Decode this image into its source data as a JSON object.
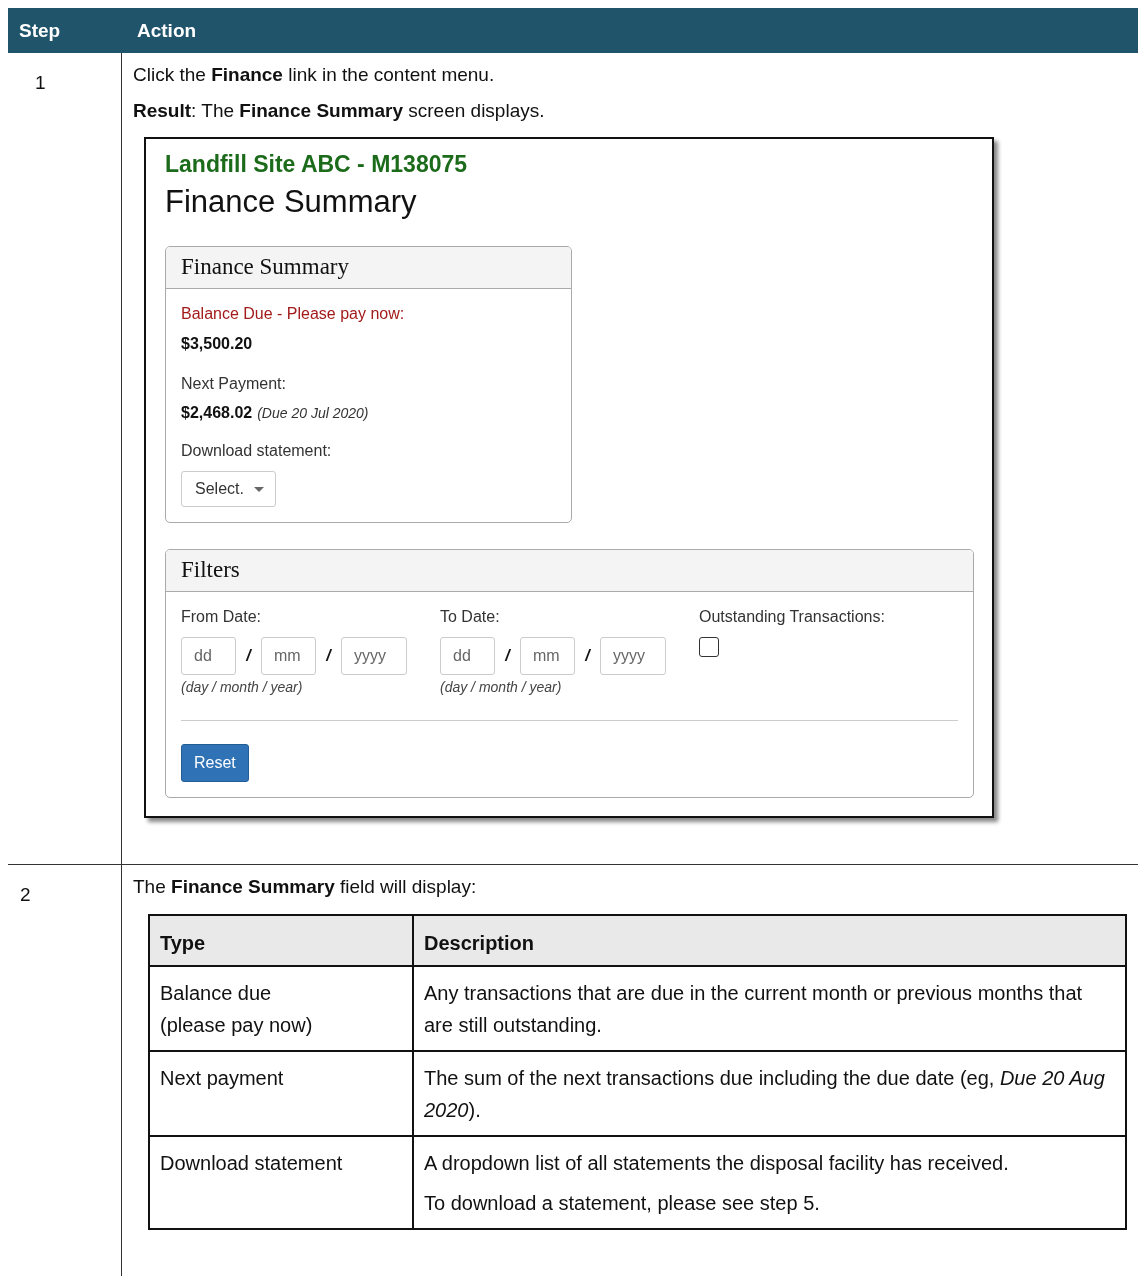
{
  "table": {
    "columns": [
      "Step",
      "Action"
    ],
    "steps": [
      {
        "number": "1",
        "paragraphs": [
          "Click the **Finance** link in the content menu.",
          "**Result**: The **Finance Summary** screen displays."
        ],
        "screen": {
          "site_title": "Landfill Site ABC - M138075",
          "page_title": "Finance Summary",
          "summary_panel": {
            "title": "Finance Summary",
            "balance_label": "Balance Due - Please pay now:",
            "balance_amount": "$3,500.20",
            "next_label": "Next Payment:",
            "next_amount": "$2,468.02",
            "next_due": "(Due 20 Jul 2020)",
            "download_label": "Download statement:",
            "download_select": "Select."
          },
          "filters_panel": {
            "title": "Filters",
            "date_groups": [
              {
                "label": "From Date:",
                "fields": [
                  {
                    "placeholder": "dd"
                  },
                  {
                    "placeholder": "mm"
                  },
                  {
                    "placeholder": "yyyy"
                  }
                ],
                "separators": [
                  "/",
                  "/"
                ],
                "hint": "(day / month / year)"
              },
              {
                "label": "To Date:",
                "fields": [
                  {
                    "placeholder": "dd"
                  },
                  {
                    "placeholder": "mm"
                  },
                  {
                    "placeholder": "yyyy"
                  }
                ],
                "separators": [
                  "/",
                  "/"
                ],
                "hint": "(day / month / year)"
              }
            ],
            "outstanding": {
              "label": "Outstanding Transactions:",
              "checked": false
            },
            "reset_button": "Reset"
          }
        }
      },
      {
        "number": "2",
        "paragraphs": [
          "The **Finance Summary** field will display:"
        ],
        "subtable": {
          "columns": [
            "Type",
            "Description"
          ],
          "rows": [
            {
              "type": [
                "Balance due",
                "(please pay now)"
              ],
              "description": [
                "Any transactions that are due in the current month or previous months that are still outstanding."
              ]
            },
            {
              "type": [
                "Next payment"
              ],
              "description": [
                "The sum of the next transactions due including the due date (eg, *Due 20 Aug 2020*)."
              ]
            },
            {
              "type": [
                "Download statement"
              ],
              "description": [
                "A dropdown list of all statements the disposal facility has received.",
                "To download a statement, please see step 5."
              ]
            }
          ]
        }
      }
    ]
  }
}
